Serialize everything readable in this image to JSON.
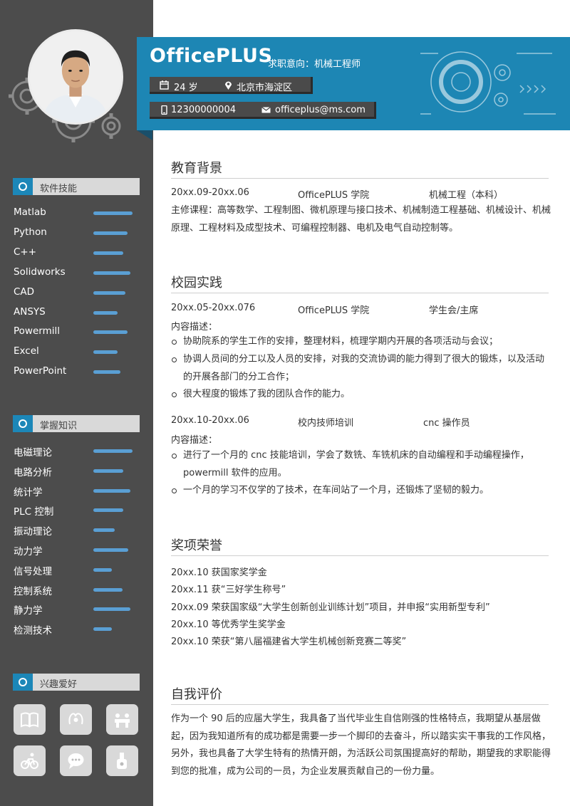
{
  "header": {
    "name": "OfficePLUS",
    "intent_label": "求职意向：",
    "intent_value": "机械工程师",
    "age": "24 岁",
    "location": "北京市海淀区",
    "phone": "12300000004",
    "email": "officeplus@ms.com"
  },
  "sidebar": {
    "software": {
      "title": "软件技能",
      "items": [
        {
          "label": "Matlab",
          "level": 0.95
        },
        {
          "label": "Python",
          "level": 0.82
        },
        {
          "label": "C++",
          "level": 0.72
        },
        {
          "label": "Solidworks",
          "level": 0.9
        },
        {
          "label": "CAD",
          "level": 0.78
        },
        {
          "label": "ANSYS",
          "level": 0.58
        },
        {
          "label": "Powermill",
          "level": 0.82
        },
        {
          "label": "Excel",
          "level": 0.58
        },
        {
          "label": "PowerPoint",
          "level": 0.66
        }
      ]
    },
    "knowledge": {
      "title": "掌握知识",
      "items": [
        {
          "label": "电磁理论",
          "level": 0.95
        },
        {
          "label": "电路分析",
          "level": 0.72
        },
        {
          "label": "统计学",
          "level": 0.9
        },
        {
          "label": "PLC 控制",
          "level": 0.72
        },
        {
          "label": "振动理论",
          "level": 0.52
        },
        {
          "label": "动力学",
          "level": 0.85
        },
        {
          "label": "信号处理",
          "level": 0.45
        },
        {
          "label": "控制系统",
          "level": 0.7
        },
        {
          "label": "静力学",
          "level": 0.9
        },
        {
          "label": "检测技术",
          "level": 0.45
        }
      ]
    },
    "hobbies": {
      "title": "兴趣爱好",
      "icons": [
        "book-icon",
        "fitness-icon",
        "team-icon",
        "cycling-icon",
        "chat-icon",
        "music-icon"
      ]
    }
  },
  "education": {
    "title": "教育背景",
    "date": "20xx.09-20xx.06",
    "school": "OfficePLUS 学院",
    "major": "机械工程（本科）",
    "courses_label": "主修课程：",
    "courses": "高等数学、工程制图、微机原理与接口技术、机械制造工程基础、机械设计、机械原理、工程材料及成型技术、可编程控制器、电机及电气自动控制等。"
  },
  "campus": {
    "title": "校园实践",
    "entry1": {
      "date": "20xx.05-20xx.076",
      "org": "OfficePLUS 学院",
      "role": "学生会/主席",
      "desc_label": "内容描述：",
      "bullets": [
        "协助院系的学生工作的安排，整理材料，梳理学期内开展的各项活动与会议；",
        "协调人员间的分工以及人员的安排，对我的交流协调的能力得到了很大的锻炼，以及活动的开展各部门的分工合作；",
        "很大程度的锻炼了我的团队合作的能力。"
      ]
    },
    "entry2": {
      "date": "20xx.10-20xx.06",
      "org": "校内技师培训",
      "role": "cnc 操作员",
      "desc_label": "内容描述：",
      "bullets": [
        "进行了一个月的 cnc 技能培训，学会了数铣、车铣机床的自动编程和手动编程操作，powermill 软件的应用。",
        "一个月的学习不仅学的了技术，在车间站了一个月，还锻炼了坚韧的毅力。"
      ]
    }
  },
  "awards": {
    "title": "奖项荣誉",
    "items": [
      "20xx.10  获国家奖学金",
      "20xx.11  获“三好学生称号”",
      "20xx.09  荣获国家级“大学生创新创业训练计划”项目，并申报“实用新型专利”",
      "20xx.10  等优秀学生奖学金",
      "20xx.10  荣获“第八届福建省大学生机械创新竞赛二等奖”"
    ]
  },
  "self_eval": {
    "title": "自我评价",
    "text": "作为一个 90 后的应届大学生，我具备了当代毕业生自信刚强的性格特点，我期望从基层做起，因为我知道所有的成功都是需要一步一个脚印的去奋斗，所以踏实实干事我的工作风格，另外，我也具备了大学生特有的热情开朗，为活跃公司氛围提高好的帮助，期望我的求职能得到您的批准，成为公司的一员，为企业发展贡献自己的一份力量。"
  },
  "colors": {
    "accent": "#1d86b4",
    "sidebar": "#4c4c4c",
    "bar": "#5a9fd4"
  }
}
